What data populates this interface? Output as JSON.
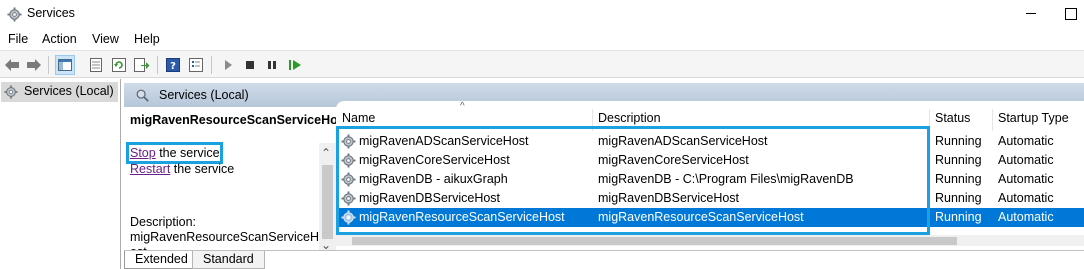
{
  "window": {
    "title": "Services"
  },
  "menu": {
    "items": [
      "File",
      "Action",
      "View",
      "Help"
    ]
  },
  "toolbar": {
    "buttons": [
      "back-icon",
      "forward-icon",
      "show-hide-console-tree-icon",
      "export-list-icon",
      "refresh-icon",
      "export-icon",
      "help-icon",
      "properties-icon",
      "start-service-icon",
      "stop-service-icon",
      "pause-service-icon",
      "restart-service-icon"
    ]
  },
  "tree": {
    "root": "Services (Local)"
  },
  "main": {
    "header": "Services (Local)",
    "detail": {
      "service_name": "migRavenResourceScanServiceHost",
      "stop_link": "Stop",
      "stop_rest": " the service",
      "restart_link": "Restart",
      "restart_rest": " the service",
      "description_label": "Description:",
      "description_value": "migRavenResourceScanServiceHost"
    },
    "columns": [
      "Name",
      "Description",
      "Status",
      "Startup Type"
    ],
    "rows": [
      {
        "name": "migRavenADScanServiceHost",
        "description": "migRavenADScanServiceHost",
        "status": "Running",
        "startup": "Automatic",
        "selected": false
      },
      {
        "name": "migRavenCoreServiceHost",
        "description": "migRavenCoreServiceHost",
        "status": "Running",
        "startup": "Automatic",
        "selected": false
      },
      {
        "name": "migRavenDB - aikuxGraph",
        "description": "migRavenDB - C:\\Program Files\\migRavenDB",
        "status": "Running",
        "startup": "Automatic",
        "selected": false
      },
      {
        "name": "migRavenDBServiceHost",
        "description": "migRavenDBServiceHost",
        "status": "Running",
        "startup": "Automatic",
        "selected": false
      },
      {
        "name": "migRavenResourceScanServiceHost",
        "description": "migRavenResourceScanServiceHost",
        "status": "Running",
        "startup": "Automatic",
        "selected": true
      }
    ]
  },
  "tabs": [
    "Extended",
    "Standard"
  ],
  "colors": {
    "highlight": "#1aa1e0",
    "selection": "#0078d7",
    "link": "#6b1f8a"
  }
}
